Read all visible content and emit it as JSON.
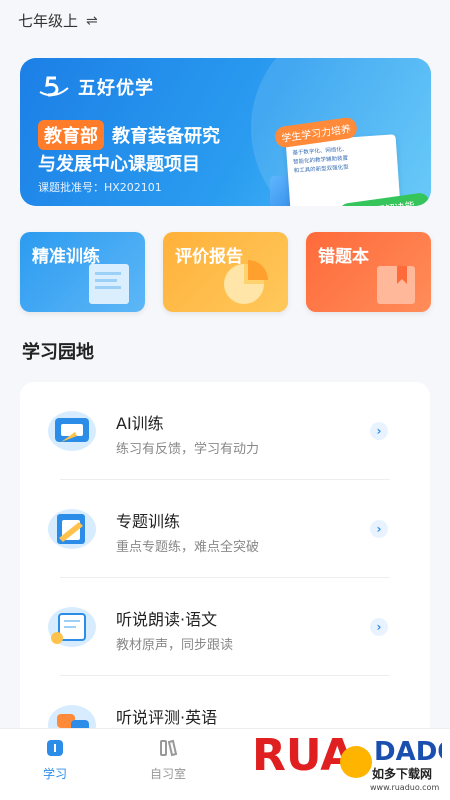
{
  "grade": {
    "label": "七年级上",
    "swap_icon": "swap-icon"
  },
  "banner": {
    "brand": "五好优学",
    "org_tag": "教育部",
    "line1_rest": "教育装备研究",
    "line2": "与发展中心课题项目",
    "approval": "课题批准号：HX202101",
    "chip_top": "学生学习力培养",
    "chip_bottom": "学生问题解决能力",
    "paper_lines": [
      "基于数字化、网络化、",
      "智能化的教学辅助装置",
      "和工具的新型双强化型"
    ]
  },
  "cards": [
    {
      "title": "精准训练",
      "icon": "document-icon",
      "color": "#2c9bf0"
    },
    {
      "title": "评价报告",
      "icon": "pie-chart-icon",
      "color": "#ffb13a"
    },
    {
      "title": "错题本",
      "icon": "notebook-icon",
      "color": "#ff6a3a"
    }
  ],
  "section": {
    "title": "学习园地"
  },
  "list": [
    {
      "title": "AI训练",
      "subtitle": "练习有反馈，学习有动力"
    },
    {
      "title": "专题训练",
      "subtitle": "重点专题练，难点全突破"
    },
    {
      "title": "听说朗读·语文",
      "subtitle": "教材原声，同步跟读"
    },
    {
      "title": "听说评测·英语",
      "subtitle": ""
    }
  ],
  "nav": {
    "tabs": [
      {
        "label": "学习",
        "active": true
      },
      {
        "label": "自习室",
        "active": false
      }
    ]
  },
  "watermark": {
    "brand": "RUANDADO",
    "subtitle": "如多下载网",
    "url": "www.ruaduo.com"
  }
}
